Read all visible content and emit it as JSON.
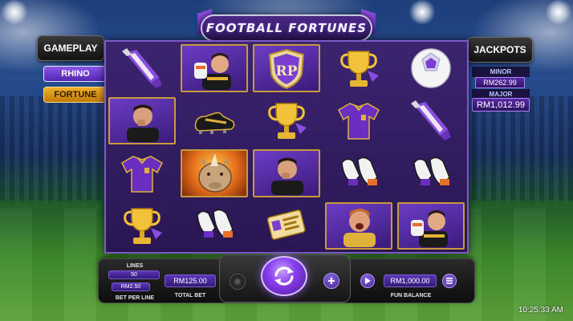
{
  "game": {
    "title": "FOOTBALL FORTUNES"
  },
  "gameplay": {
    "heading": "GAMEPLAY",
    "modes": [
      {
        "label": "RHINO",
        "state": "active"
      },
      {
        "label": "FORTUNE",
        "state": "inactive"
      }
    ]
  },
  "jackpots": {
    "heading": "JACKPOTS",
    "minor": {
      "label": "MINOR",
      "value": "RM262.99"
    },
    "major": {
      "label": "MAJOR",
      "value": "RM1,012.99"
    }
  },
  "reels": {
    "rows": [
      [
        "scarf",
        "goalkeeper",
        "rp-badge",
        "trophy",
        "football"
      ],
      [
        "player-portrait",
        "boot",
        "trophy",
        "jersey",
        "scarf"
      ],
      [
        "jersey",
        "rhino",
        "player-portrait",
        "gloves",
        "gloves"
      ],
      [
        "trophy",
        "gloves",
        "card",
        "goalkeeper-shouting",
        "goalkeeper"
      ]
    ],
    "framed": [
      [
        0,
        1
      ],
      [
        0,
        2
      ],
      [
        1,
        0
      ],
      [
        2,
        1
      ],
      [
        2,
        2
      ],
      [
        3,
        3
      ],
      [
        3,
        4
      ]
    ],
    "badge_letters": "RP"
  },
  "controls": {
    "lines_label": "LINES",
    "lines_value": "50",
    "bet_per_line_value": "RM2.50",
    "bet_per_line_label": "BET PER LINE",
    "total_bet_value": "RM125.00",
    "total_bet_label": "TOTAL BET",
    "fun_balance_value": "RM1,000.00",
    "fun_balance_label": "FUN BALANCE"
  },
  "clock": "10:25:33 AM",
  "colors": {
    "accent_purple": "#6a3bd1",
    "gold": "#e0b13b",
    "frame_gold": "#c99a3a"
  }
}
